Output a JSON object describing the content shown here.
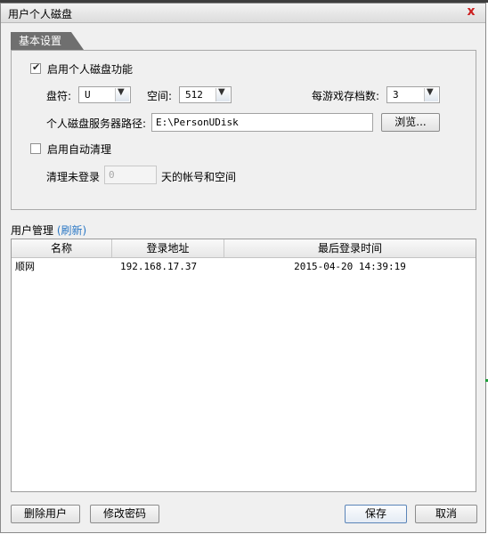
{
  "window": {
    "title": "用户个人磁盘",
    "close_label": "x"
  },
  "tab": {
    "label": "基本设置"
  },
  "settings": {
    "enable_disk": {
      "label": "启用个人磁盘功能",
      "checked": true
    },
    "drive": {
      "label": "盘符:",
      "value": "U"
    },
    "space": {
      "label": "空间:",
      "value": "512"
    },
    "saves": {
      "label": "每游戏存档数:",
      "value": "3"
    },
    "server_path": {
      "label": "个人磁盘服务器路径:",
      "value": "E:\\PersonUDisk"
    },
    "browse_label": "浏览...",
    "auto_clean": {
      "label": "启用自动清理",
      "checked": false
    },
    "clean": {
      "prefix": "清理未登录",
      "value": "0",
      "suffix": "天的帐号和空间"
    }
  },
  "users": {
    "section_title": "用户管理",
    "refresh_label": "(刷新)",
    "columns": [
      "名称",
      "登录地址",
      "最后登录时间"
    ],
    "rows": [
      {
        "name": "顺网",
        "address": "192.168.17.37",
        "last_login": "2015-04-20 14:39:19"
      }
    ]
  },
  "footer": {
    "delete_label": "删除用户",
    "change_password_label": "修改密码",
    "save_label": "保存",
    "cancel_label": "取消"
  },
  "colors": {
    "tab_bg": "#6f6f6f",
    "link": "#2b78c5",
    "close": "#cc2020"
  }
}
